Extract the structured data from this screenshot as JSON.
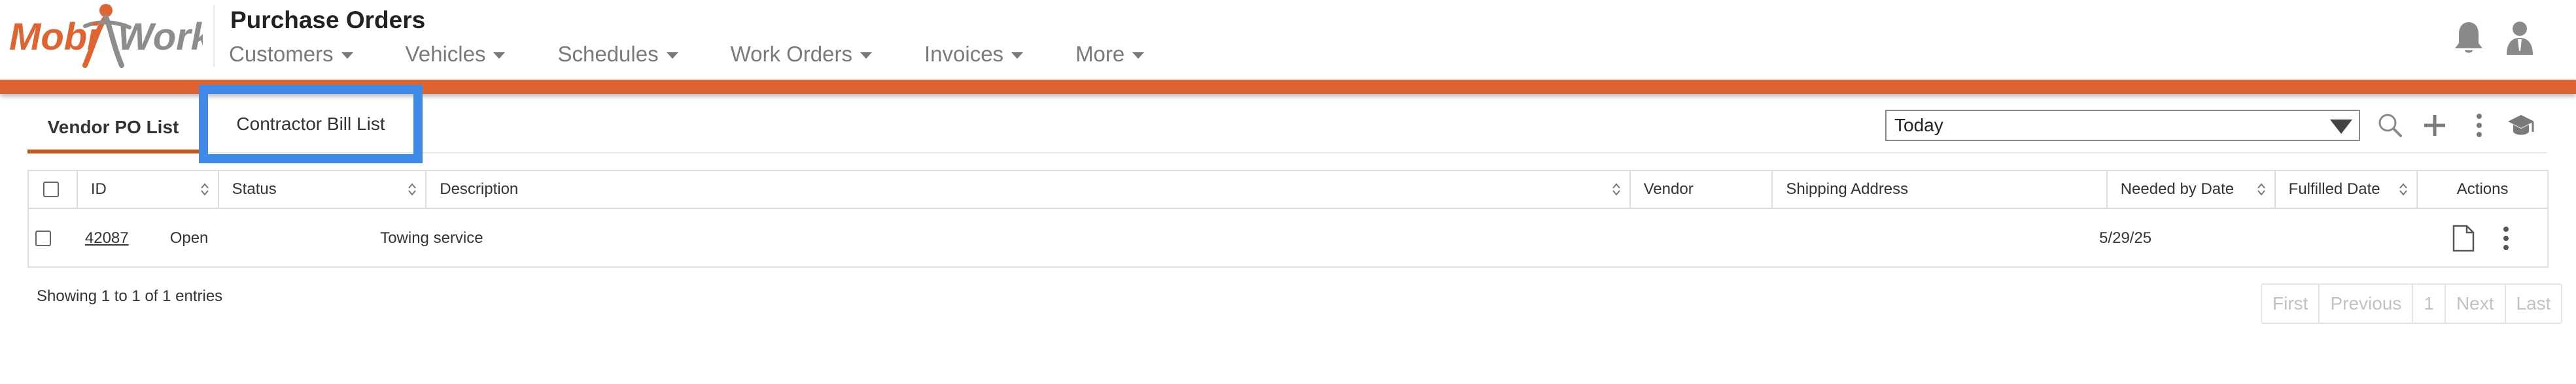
{
  "header": {
    "logo_text_left": "Mobi",
    "logo_text_right": "Work",
    "title": "Purchase Orders",
    "nav": [
      {
        "label": "Customers"
      },
      {
        "label": "Vehicles"
      },
      {
        "label": "Schedules"
      },
      {
        "label": "Work Orders"
      },
      {
        "label": "Invoices"
      },
      {
        "label": "More"
      }
    ],
    "icons": [
      "bell-icon",
      "user-icon"
    ],
    "accent_color": "#e06431"
  },
  "tabs": {
    "vendor": "Vendor PO List",
    "contractor": "Contractor Bill List"
  },
  "toolbar": {
    "date_filter": "Today",
    "icons": [
      "search-icon",
      "plus-icon",
      "more-vertical-icon",
      "graduation-cap-icon"
    ]
  },
  "table": {
    "columns": {
      "id": "ID",
      "status": "Status",
      "description": "Description",
      "vendor": "Vendor",
      "shipping": "Shipping Address",
      "needed": "Needed by Date",
      "fulfilled": "Fulfilled Date",
      "actions": "Actions"
    },
    "rows": [
      {
        "id": "42087",
        "status": "Open",
        "description": "Towing service",
        "vendor": "",
        "shipping": "",
        "needed": "5/29/25",
        "fulfilled": ""
      }
    ]
  },
  "footer": {
    "entries": "Showing 1 to 1 of 1 entries",
    "pager": {
      "first": "First",
      "previous": "Previous",
      "page": "1",
      "next": "Next",
      "last": "Last"
    }
  }
}
